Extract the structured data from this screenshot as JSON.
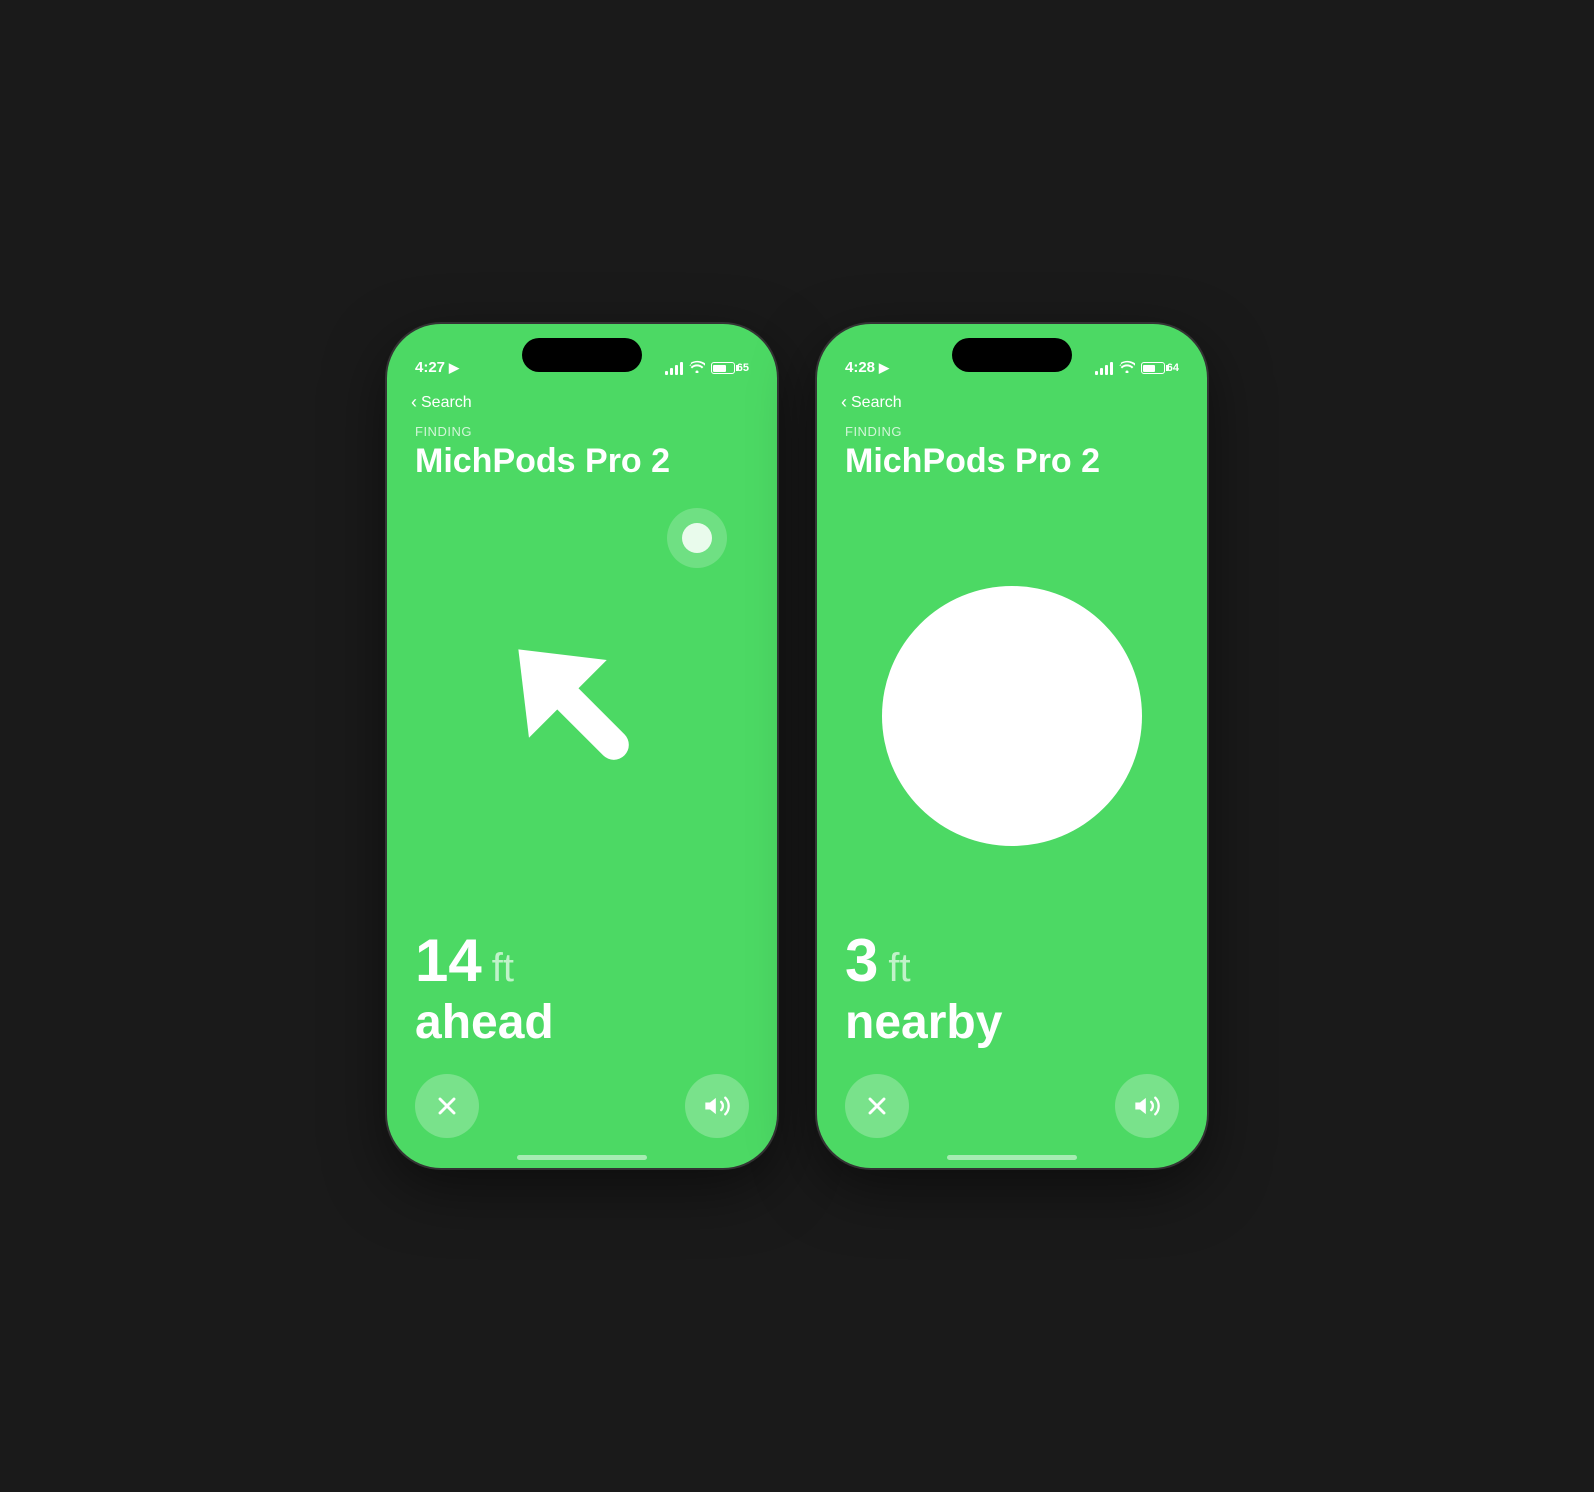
{
  "phone1": {
    "status": {
      "time": "4:27",
      "back_label": "Search",
      "battery_percent": "65",
      "battery_fill_pct": 65
    },
    "finding_label": "FINDING",
    "device_name": "MichPods Pro 2",
    "distance_number": "14",
    "distance_unit": "ft",
    "direction_text": "ahead",
    "close_button_label": "×",
    "sound_button_label": "🔊"
  },
  "phone2": {
    "status": {
      "time": "4:28",
      "back_label": "Search",
      "battery_percent": "64",
      "battery_fill_pct": 64
    },
    "finding_label": "FINDING",
    "device_name": "MichPods Pro 2",
    "distance_number": "3",
    "distance_unit": "ft",
    "direction_text": "nearby",
    "close_button_label": "×",
    "sound_button_label": "🔊"
  },
  "colors": {
    "bg_green": "#4cd964",
    "white": "#ffffff"
  }
}
